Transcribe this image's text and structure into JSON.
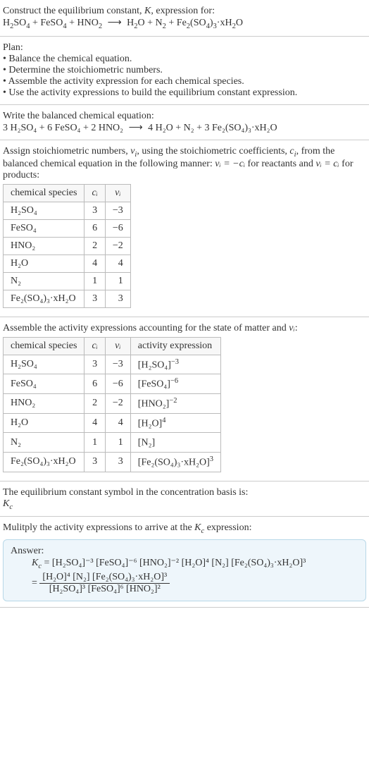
{
  "header": {
    "line1_pre": "Construct the equilibrium constant, ",
    "line1_k": "K",
    "line1_post": ", expression for:",
    "eq_lhs_parts": [
      "H",
      "2",
      "SO",
      "4",
      " + FeSO",
      "4",
      " + HNO",
      "2"
    ],
    "arrow": "⟶",
    "eq_rhs_parts": [
      "H",
      "2",
      "O + N",
      "2",
      " + Fe",
      "2",
      "(SO",
      "4",
      ")",
      "3",
      "·xH",
      "2",
      "O"
    ]
  },
  "plan": {
    "title": "Plan:",
    "items": [
      "Balance the chemical equation.",
      "Determine the stoichiometric numbers.",
      "Assemble the activity expression for each chemical species.",
      "Use the activity expressions to build the equilibrium constant expression."
    ]
  },
  "balanced": {
    "title": "Write the balanced chemical equation:",
    "lhs": "3 H₂SO₄ + 6 FeSO₄ + 2 HNO₂",
    "arrow": "⟶",
    "rhs": "4 H₂O + N₂ + 3 Fe₂(SO₄)₃·xH₂O"
  },
  "assign": {
    "text_pre": "Assign stoichiometric numbers, ",
    "nu": "ν",
    "text_mid1": ", using the stoichiometric coefficients, ",
    "c": "c",
    "text_mid2": ", from the balanced chemical equation in the following manner: ",
    "rel_react": "νᵢ = −cᵢ",
    "text_mid3": " for reactants and ",
    "rel_prod": "νᵢ = cᵢ",
    "text_mid4": " for products:"
  },
  "table1": {
    "headers": [
      "chemical species",
      "cᵢ",
      "νᵢ"
    ],
    "rows": [
      {
        "sp": "H₂SO₄",
        "c": "3",
        "v": "−3"
      },
      {
        "sp": "FeSO₄",
        "c": "6",
        "v": "−6"
      },
      {
        "sp": "HNO₂",
        "c": "2",
        "v": "−2"
      },
      {
        "sp": "H₂O",
        "c": "4",
        "v": "4"
      },
      {
        "sp": "N₂",
        "c": "1",
        "v": "1"
      },
      {
        "sp": "Fe₂(SO₄)₃·xH₂O",
        "c": "3",
        "v": "3"
      }
    ]
  },
  "assemble": {
    "text_pre": "Assemble the activity expressions accounting for the state of matter and ",
    "nu": "νᵢ",
    "text_post": ":"
  },
  "table2": {
    "headers": [
      "chemical species",
      "cᵢ",
      "νᵢ",
      "activity expression"
    ],
    "rows": [
      {
        "sp": "H₂SO₄",
        "c": "3",
        "v": "−3",
        "a_base": "[H₂SO₄]",
        "a_exp": "−3"
      },
      {
        "sp": "FeSO₄",
        "c": "6",
        "v": "−6",
        "a_base": "[FeSO₄]",
        "a_exp": "−6"
      },
      {
        "sp": "HNO₂",
        "c": "2",
        "v": "−2",
        "a_base": "[HNO₂]",
        "a_exp": "−2"
      },
      {
        "sp": "H₂O",
        "c": "4",
        "v": "4",
        "a_base": "[H₂O]",
        "a_exp": "4"
      },
      {
        "sp": "N₂",
        "c": "1",
        "v": "1",
        "a_base": "[N₂]",
        "a_exp": ""
      },
      {
        "sp": "Fe₂(SO₄)₃·xH₂O",
        "c": "3",
        "v": "3",
        "a_base": "[Fe₂(SO₄)₃·xH₂O]",
        "a_exp": "3"
      }
    ]
  },
  "symbol": {
    "line1": "The equilibrium constant symbol in the concentration basis is:",
    "kc": "K",
    "kc_sub": "c"
  },
  "multiply": {
    "text_pre": "Mulitply the activity expressions to arrive at the ",
    "kc": "K",
    "kc_sub": "c",
    "text_post": " expression:"
  },
  "answer": {
    "label": "Answer:",
    "kc": "K",
    "kc_sub": "c",
    "eq": " = ",
    "flat": "[H₂SO₄]⁻³ [FeSO₄]⁻⁶ [HNO₂]⁻² [H₂O]⁴ [N₂] [Fe₂(SO₄)₃·xH₂O]³",
    "num": "[H₂O]⁴ [N₂] [Fe₂(SO₄)₃·xH₂O]³",
    "den": "[H₂SO₄]³ [FeSO₄]⁶ [HNO₂]²"
  },
  "chart_data": {
    "type": "table",
    "tables": [
      {
        "title": "Stoichiometric numbers",
        "columns": [
          "chemical species",
          "c_i",
          "ν_i"
        ],
        "rows": [
          [
            "H2SO4",
            3,
            -3
          ],
          [
            "FeSO4",
            6,
            -6
          ],
          [
            "HNO2",
            2,
            -2
          ],
          [
            "H2O",
            4,
            4
          ],
          [
            "N2",
            1,
            1
          ],
          [
            "Fe2(SO4)3·xH2O",
            3,
            3
          ]
        ]
      },
      {
        "title": "Activity expressions",
        "columns": [
          "chemical species",
          "c_i",
          "ν_i",
          "activity expression"
        ],
        "rows": [
          [
            "H2SO4",
            3,
            -3,
            "[H2SO4]^-3"
          ],
          [
            "FeSO4",
            6,
            -6,
            "[FeSO4]^-6"
          ],
          [
            "HNO2",
            2,
            -2,
            "[HNO2]^-2"
          ],
          [
            "H2O",
            4,
            4,
            "[H2O]^4"
          ],
          [
            "N2",
            1,
            1,
            "[N2]"
          ],
          [
            "Fe2(SO4)3·xH2O",
            3,
            3,
            "[Fe2(SO4)3·xH2O]^3"
          ]
        ]
      }
    ]
  }
}
